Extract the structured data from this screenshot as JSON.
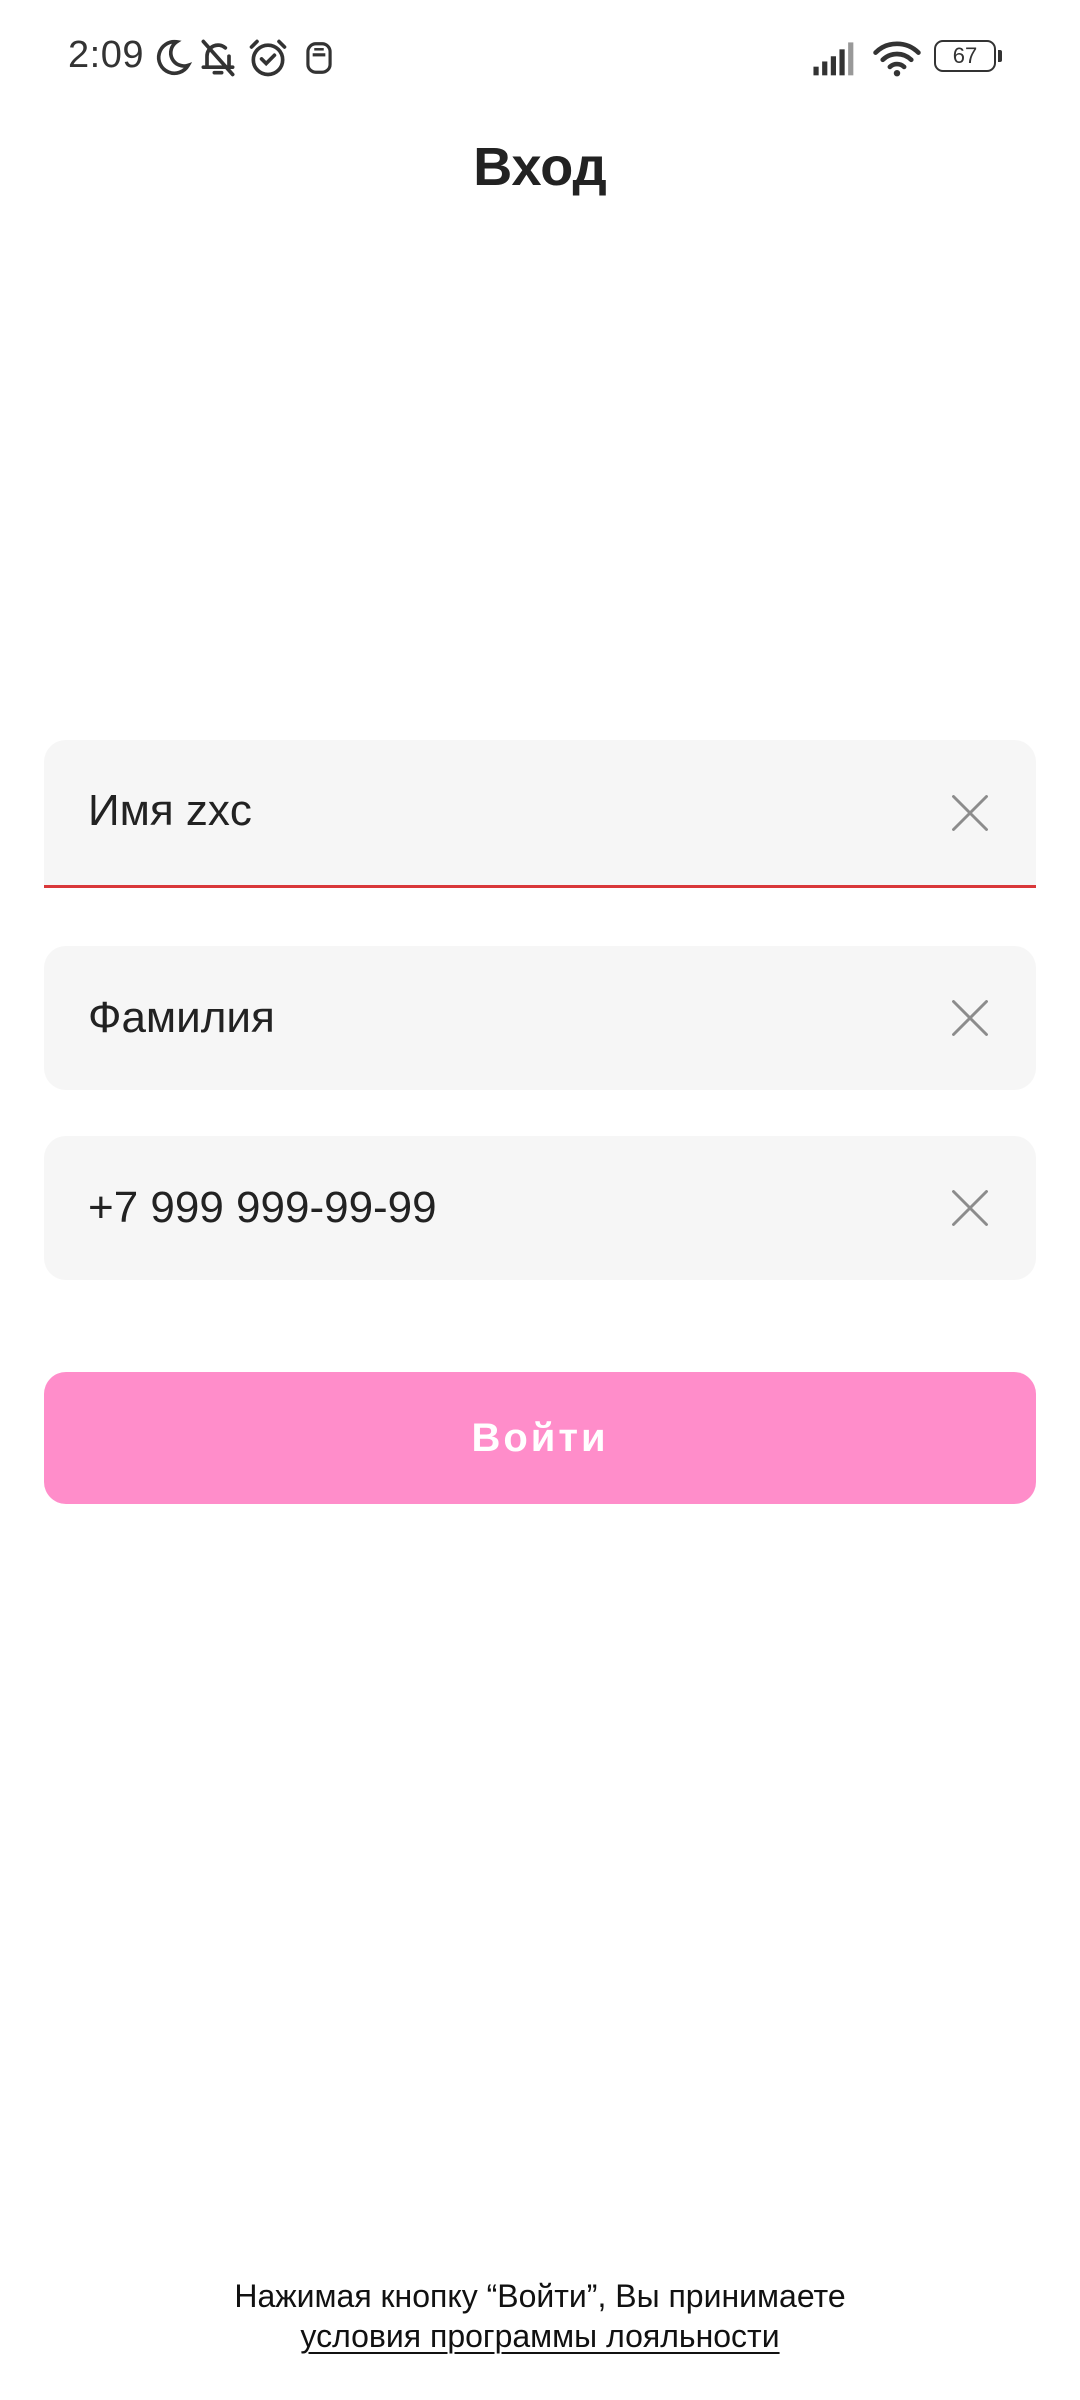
{
  "status_bar": {
    "time": "2:09",
    "battery_level": "67",
    "icons": [
      "moon-icon",
      "bell-off-icon",
      "alarm-icon",
      "app-notification-icon",
      "signal-icon",
      "wifi-icon",
      "battery-icon"
    ]
  },
  "header": {
    "title": "Вход"
  },
  "form": {
    "first_name": {
      "value": "Имя zxc",
      "state": "error",
      "clear_icon": "close-icon"
    },
    "last_name": {
      "value": "Фамилия",
      "clear_icon": "close-icon"
    },
    "phone": {
      "value": "+7 999 999-99-99",
      "clear_icon": "close-icon"
    },
    "submit_label": "Войти"
  },
  "footer": {
    "notice": "Нажимая кнопку “Войти”, Вы принимаете",
    "link_label": "условия программы лояльности"
  },
  "colors": {
    "accent": "#ff8dca",
    "error_line": "#d9383a",
    "field_background": "#f6f6f6",
    "text": "#222222"
  }
}
